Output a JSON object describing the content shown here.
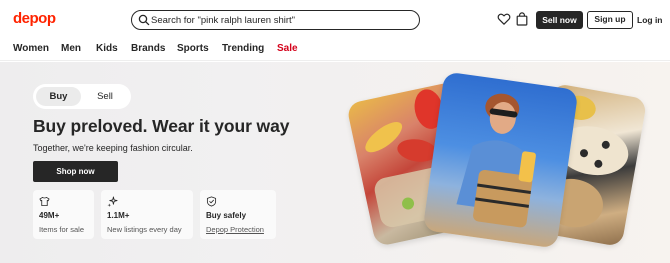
{
  "header": {
    "logo_text": "depop",
    "search": {
      "value": "Search for \"pink ralph lauren shirt\"",
      "icon": "search-icon"
    },
    "icons": [
      "heart-icon",
      "bag-icon"
    ],
    "sell_now": "Sell now",
    "sign_up": "Sign up",
    "log_in": "Log in"
  },
  "nav": {
    "categories": [
      "Women",
      "Men",
      "Kids",
      "Brands",
      "Sports",
      "Trending",
      "Sale"
    ]
  },
  "hero": {
    "toggle": {
      "buy": "Buy",
      "sell": "Sell",
      "selected": "Buy"
    },
    "title": "Buy preloved. Wear it your way",
    "subtitle": "Together, we're keeping fashion circular.",
    "cta": "Shop now",
    "stats": [
      {
        "icon": "tshirt-icon",
        "value": "49M+",
        "label": "Items for sale"
      },
      {
        "icon": "sparkle-icon",
        "value": "1.1M+",
        "label": "New listings every day"
      },
      {
        "icon": "shield-icon",
        "value": "Buy safely",
        "label": "Depop Protection"
      }
    ]
  },
  "colors": {
    "brand": "#ff2300",
    "sale": "#d4001a",
    "dark": "#262626"
  }
}
